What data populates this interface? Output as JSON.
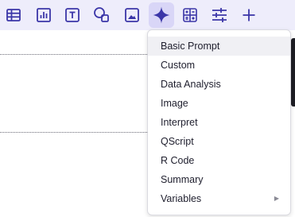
{
  "toolbar": {
    "buttons": [
      {
        "icon": "table-icon",
        "active": false
      },
      {
        "icon": "bar-chart-icon",
        "active": false
      },
      {
        "icon": "text-box-icon",
        "active": false
      },
      {
        "icon": "shapes-icon",
        "active": false
      },
      {
        "icon": "image-icon",
        "active": false
      },
      {
        "icon": "sparkle-icon",
        "active": true
      },
      {
        "icon": "calculation-icon",
        "active": false
      },
      {
        "icon": "filter-sliders-icon",
        "active": false
      },
      {
        "icon": "plus-icon",
        "active": false
      }
    ],
    "accent_color": "#3b36a8"
  },
  "menu": {
    "items": [
      {
        "label": "Basic Prompt",
        "highlighted": true
      },
      {
        "label": "Custom"
      },
      {
        "label": "Data Analysis"
      },
      {
        "label": "Image"
      },
      {
        "label": "Interpret"
      },
      {
        "label": "QScript"
      },
      {
        "label": "R Code"
      },
      {
        "label": "Summary"
      },
      {
        "label": "Variables",
        "has_submenu": true,
        "submenu_icon": "chevron-right-icon"
      }
    ]
  }
}
